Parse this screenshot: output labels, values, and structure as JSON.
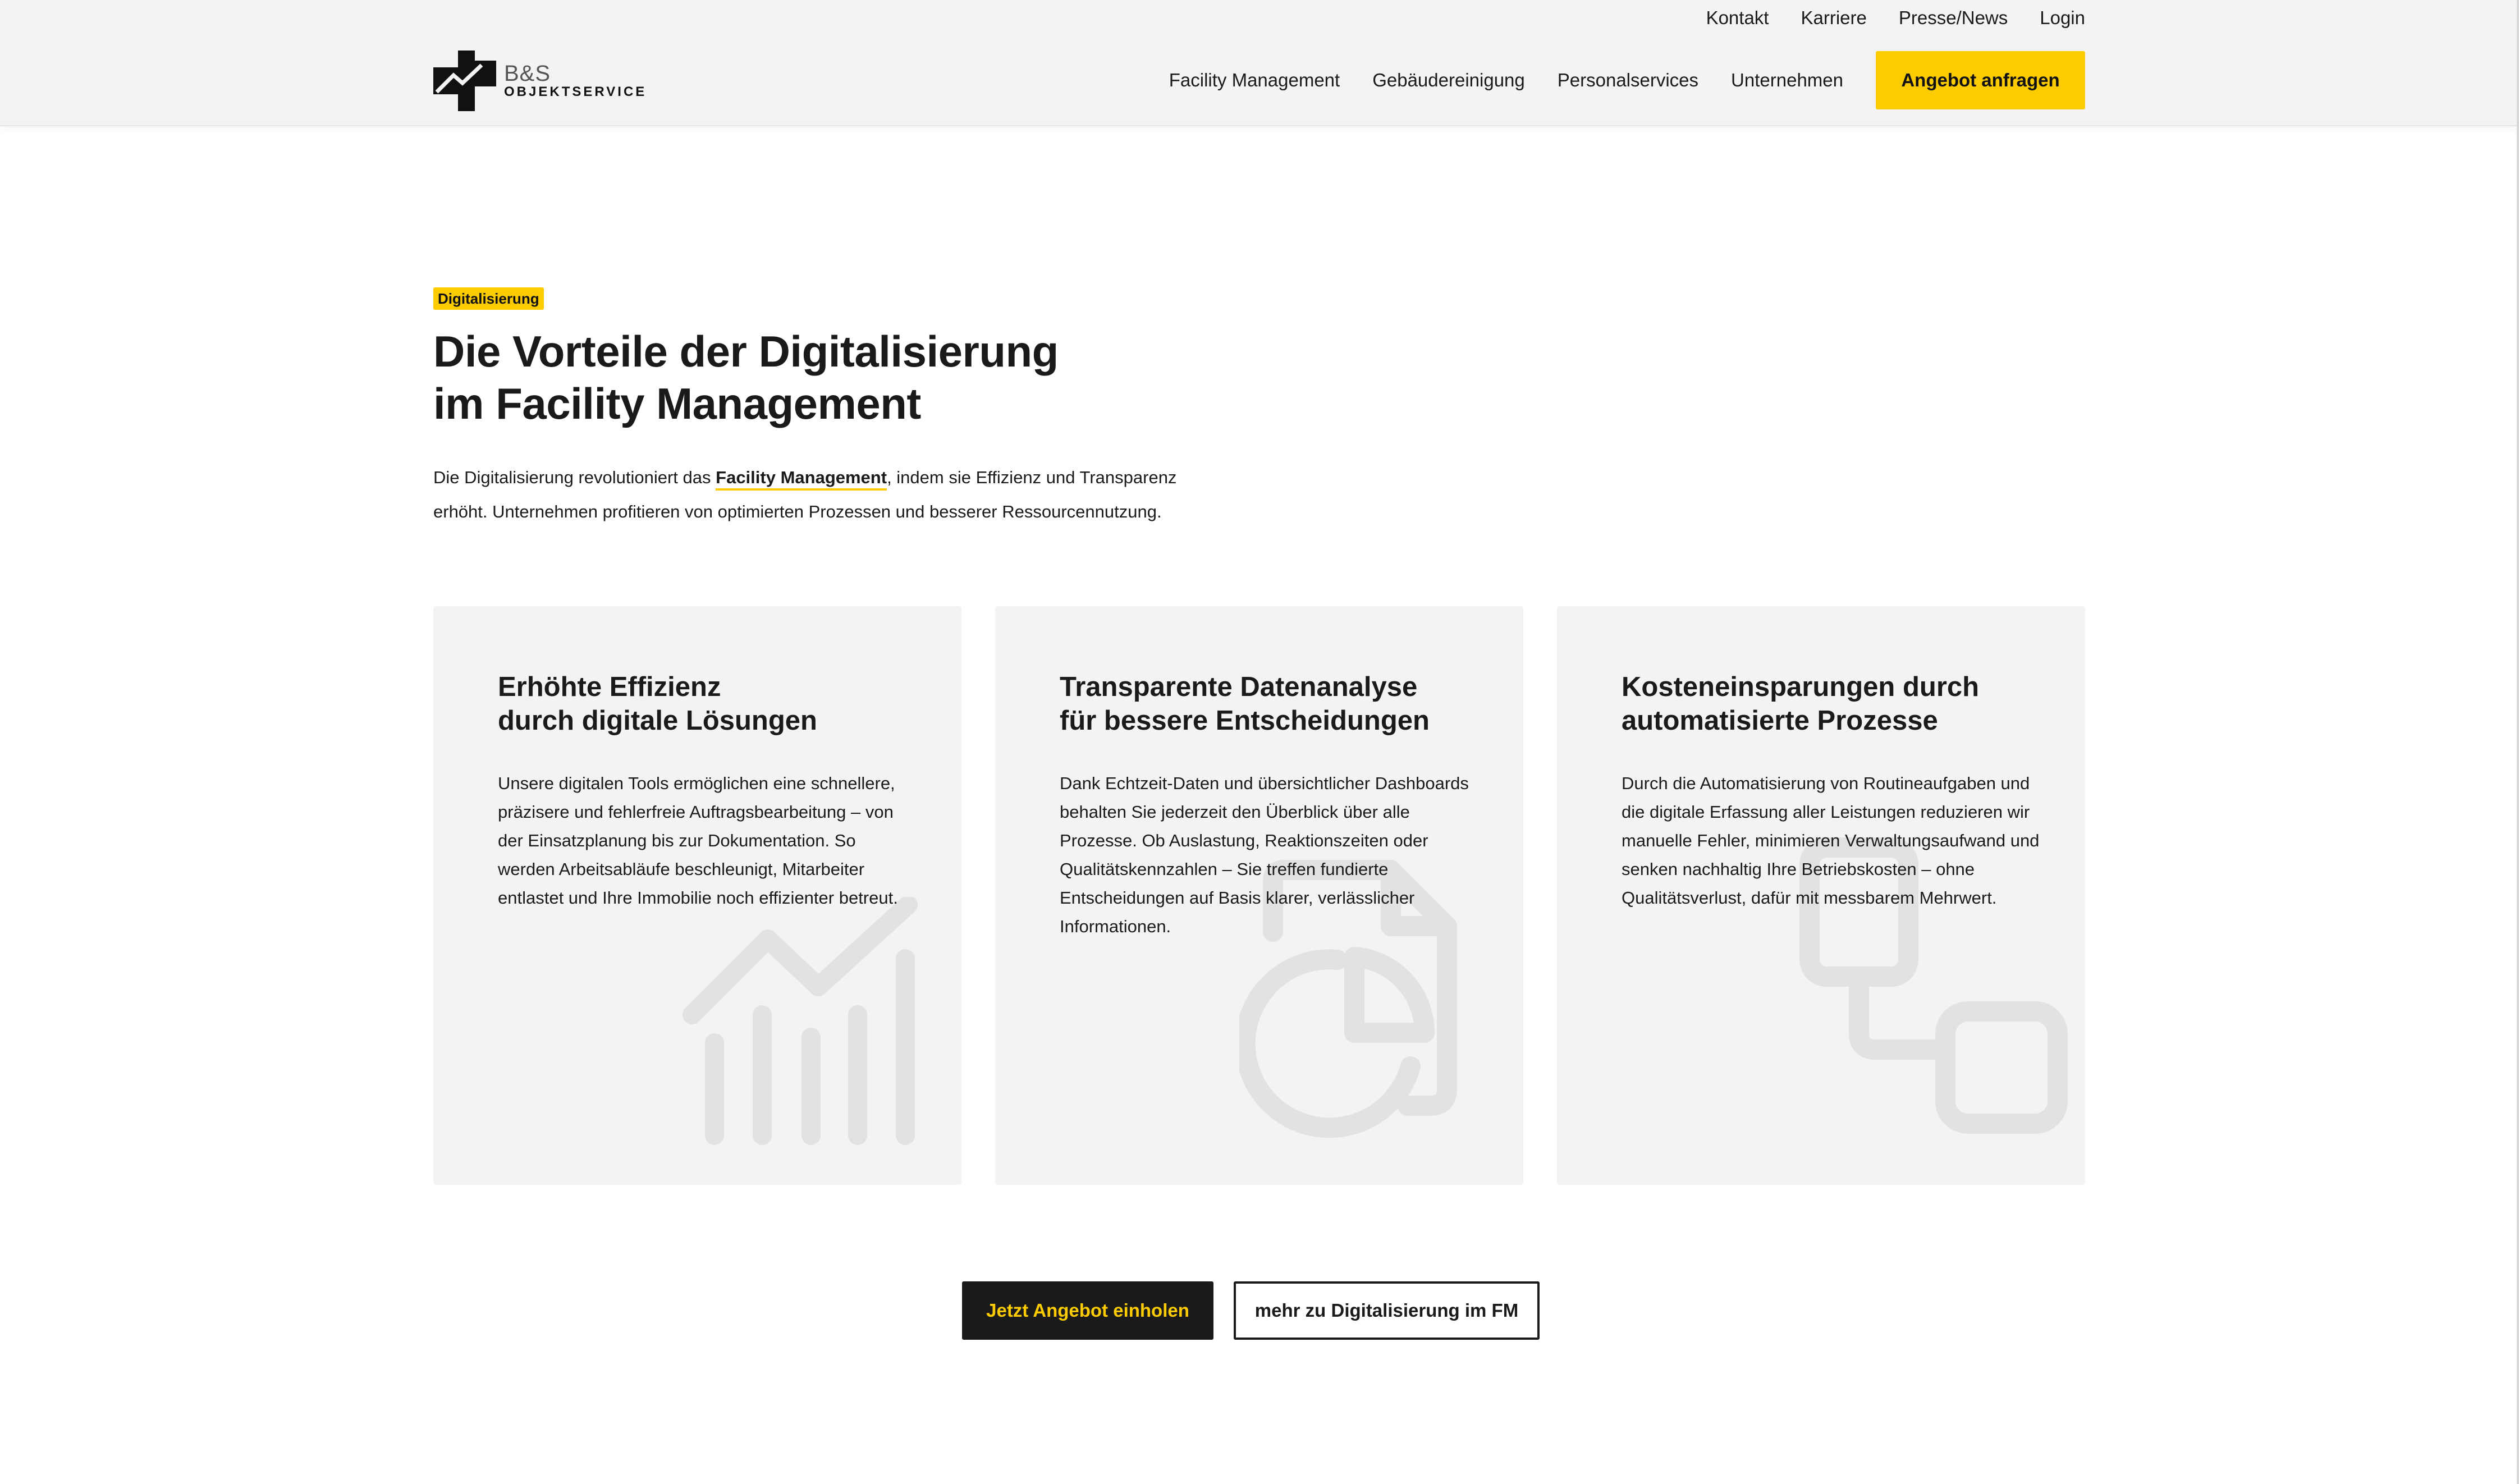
{
  "colors": {
    "accent": "#fccc00",
    "dark": "#1a1a1a",
    "card_bg": "#f3f3f3"
  },
  "topbar": {
    "links": [
      "Kontakt",
      "Karriere",
      "Presse/News",
      "Login"
    ]
  },
  "header": {
    "logo": {
      "brand": "B&S",
      "sub": "OBJEKTSERVICE"
    },
    "nav": [
      "Facility Management",
      "Gebäudereinigung",
      "Personalservices",
      "Unternehmen"
    ],
    "cta": "Angebot anfragen"
  },
  "hero": {
    "tag": "Digitalisierung",
    "title_line1": "Die Vorteile der Digitalisierung",
    "title_line2": "im Facility Management",
    "intro_before": "Die Digitalisierung revolutioniert das ",
    "intro_link": "Facility Management",
    "intro_after": ", indem sie Effizienz und Transparenz erhöht. Unternehmen profitieren von optimierten Prozessen und besserer Ressourcennutzung."
  },
  "cards": [
    {
      "title": "Erhöhte Effizienz\ndurch digitale Lösungen",
      "text": "Unsere digitalen Tools ermöglichen eine schnellere, präzisere und fehlerfreie Auftragsbearbeitung – von der Einsatzplanung bis zur Dokumentation. So werden Arbeitsabläufe beschleunigt, Mitarbeiter entlastet und Ihre Immobilie noch effizienter betreut.",
      "icon": "growth-chart-icon"
    },
    {
      "title": "Transparente Datenanalyse\nfür bessere Entscheidungen",
      "text": "Dank Echtzeit-Daten und übersichtlicher Dashboards behalten Sie jederzeit den Überblick über alle Prozesse. Ob Auslastung, Reaktionszeiten oder Qualitätskennzahlen – Sie treffen fundierte Entscheidungen auf Basis klarer, verlässlicher Informationen.",
      "icon": "report-pie-icon"
    },
    {
      "title": "Kosteneinsparungen durch\nautomatisierte Prozesse",
      "text": "Durch die Automatisierung von Routineaufgaben und die digitale Erfassung aller Leistungen reduzieren wir manuelle Fehler, minimieren Verwaltungsaufwand und senken nachhaltig Ihre Betriebskosten – ohne Qualitätsverlust, dafür mit messbarem Mehrwert.",
      "icon": "workflow-icon"
    }
  ],
  "buttons": {
    "primary": "Jetzt Angebot einholen",
    "secondary": "mehr zu Digitalisierung im FM"
  }
}
